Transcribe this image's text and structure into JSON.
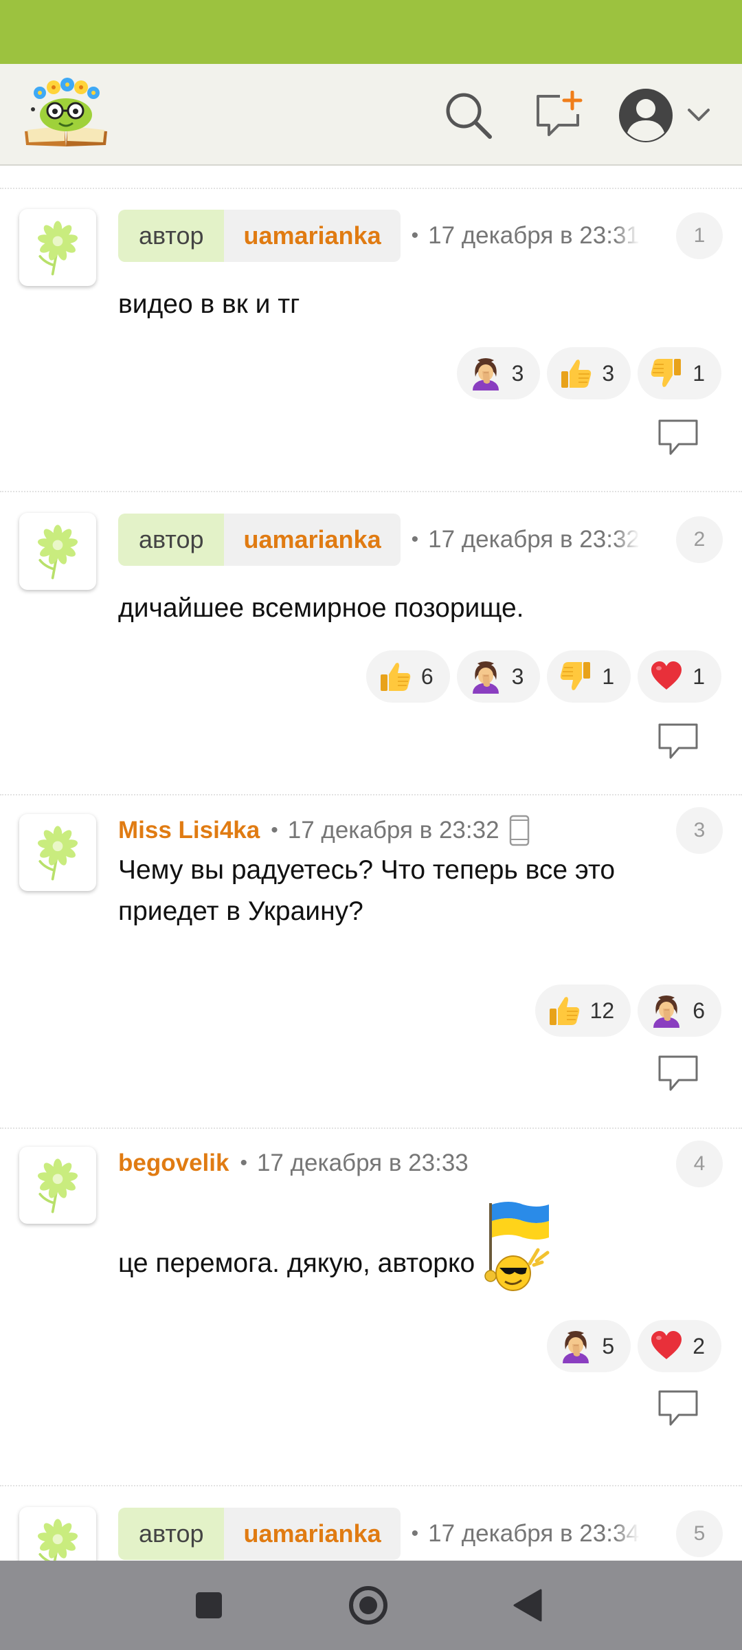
{
  "colors": {
    "status_bar": "#9cc23f",
    "accent": "#e07b12",
    "author_tag_bg": "#e3f2c8",
    "header_bg": "#f2f2ec",
    "nav_bar": "#8e8e92"
  },
  "header": {
    "icons": [
      "app-logo",
      "search-icon",
      "new-post-icon",
      "profile-icon",
      "chevron-down-icon"
    ]
  },
  "comments": [
    {
      "number": "1",
      "author_label": "автор",
      "username": "uamarianka",
      "time": "17 декабря в 23:31",
      "text": "видео в вк и тг",
      "reactions": [
        {
          "emoji": "facepalm",
          "count": "3"
        },
        {
          "emoji": "thumbs-up",
          "count": "3"
        },
        {
          "emoji": "thumbs-down",
          "count": "1"
        }
      ]
    },
    {
      "number": "2",
      "author_label": "автор",
      "username": "uamarianka",
      "time": "17 декабря в 23:32",
      "text": "дичайшее всемирное позорище.",
      "reactions": [
        {
          "emoji": "thumbs-up",
          "count": "6"
        },
        {
          "emoji": "facepalm",
          "count": "3"
        },
        {
          "emoji": "thumbs-down",
          "count": "1"
        },
        {
          "emoji": "heart",
          "count": "1"
        }
      ]
    },
    {
      "number": "3",
      "username": "Miss Lisi4ka",
      "time": "17 декабря в 23:32",
      "text": "Чему вы радуетесь? Что теперь все это приедет в Украину?",
      "reactions": [
        {
          "emoji": "thumbs-up",
          "count": "12"
        },
        {
          "emoji": "facepalm",
          "count": "6"
        }
      ]
    },
    {
      "number": "4",
      "username": "begovelik",
      "time": "17 декабря в 23:33",
      "text": "це перемога. дякую, авторко",
      "reactions": [
        {
          "emoji": "facepalm",
          "count": "5"
        },
        {
          "emoji": "heart",
          "count": "2"
        }
      ]
    },
    {
      "number": "5",
      "author_label": "автор",
      "username": "uamarianka",
      "time": "17 декабря в 23:34"
    }
  ]
}
